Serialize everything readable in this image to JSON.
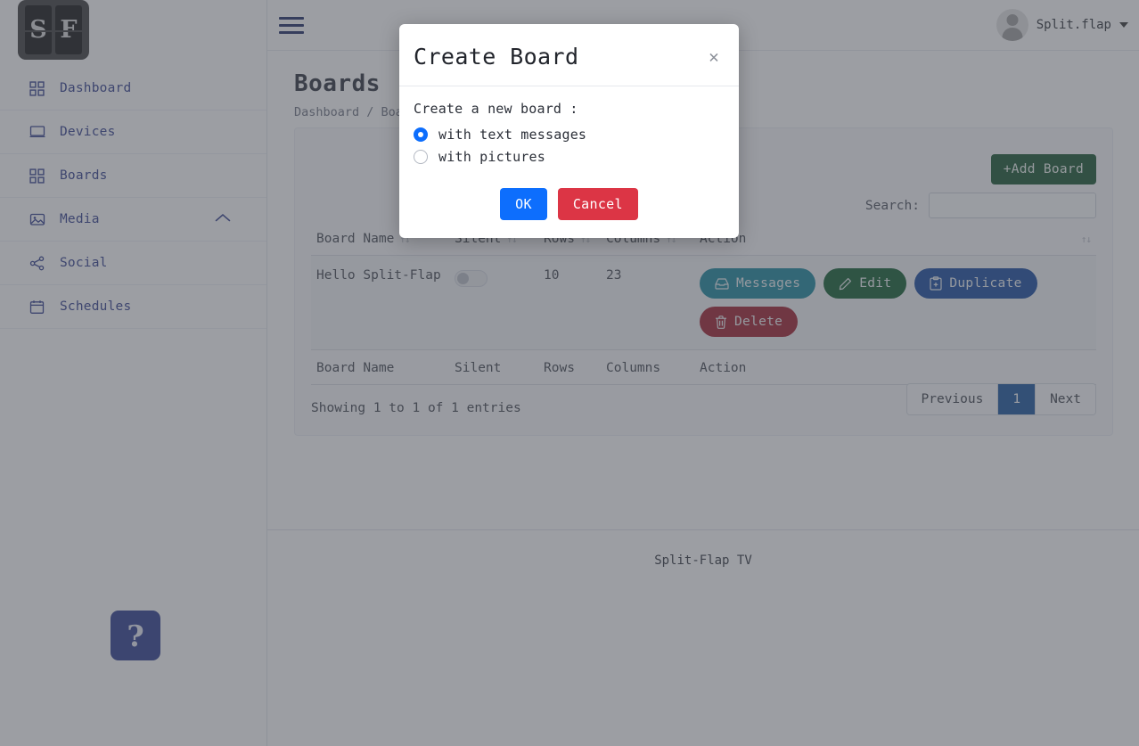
{
  "brand": {
    "tile_1": "S",
    "tile_2": "F"
  },
  "sidebar": {
    "items": [
      {
        "label": "Dashboard",
        "icon": "grid-icon"
      },
      {
        "label": "Devices",
        "icon": "monitor-icon"
      },
      {
        "label": "Boards",
        "icon": "grid-icon"
      },
      {
        "label": "Media",
        "icon": "image-icon",
        "expander": "chevron-up-icon"
      },
      {
        "label": "Social",
        "icon": "share-icon"
      },
      {
        "label": "Schedules",
        "icon": "calendar-icon"
      }
    ]
  },
  "topbar": {
    "menu_icon": "hamburger-icon",
    "user_name": "Split.flap",
    "caret_icon": "caret-down-icon"
  },
  "page": {
    "title": "Boards",
    "breadcrumb": "Dashboard / Boards"
  },
  "toolbar": {
    "add_board_label": "+Add Board",
    "search_label": "Search:",
    "search_value": "",
    "search_placeholder": ""
  },
  "table": {
    "headers": [
      "Board Name",
      "Silent",
      "Rows",
      "Columns",
      "Action"
    ],
    "footers": [
      "Board Name",
      "Silent",
      "Rows",
      "Columns",
      "Action"
    ],
    "sort_icon": "sort-arrows-icon",
    "rows": [
      {
        "name": "Hello Split-Flap",
        "silent": false,
        "rows": "10",
        "columns": "23",
        "actions": [
          {
            "label": "Messages",
            "icon": "inbox-icon",
            "color": "#17859b"
          },
          {
            "label": "Edit",
            "icon": "pencil-icon",
            "color": "#0f5c2e"
          },
          {
            "label": "Duplicate",
            "icon": "clipboard-plus-icon",
            "color": "#14489e"
          },
          {
            "label": "Delete",
            "icon": "trash-icon",
            "color": "#9e1b2a"
          }
        ]
      }
    ],
    "entries_info": "Showing 1 to 1 of 1 entries",
    "pagination": {
      "previous_label": "Previous",
      "pages": [
        "1"
      ],
      "active_page": "1",
      "next_label": "Next"
    }
  },
  "footer": {
    "text": "Split-Flap TV"
  },
  "help": {
    "label": "?",
    "icon": "question-mark-icon"
  },
  "modal": {
    "title": "Create Board",
    "close_icon": "close-icon",
    "prompt": "Create a new board :",
    "options": [
      {
        "label": "with text messages",
        "selected": true
      },
      {
        "label": "with pictures",
        "selected": false
      }
    ],
    "ok_label": "OK",
    "cancel_label": "Cancel"
  },
  "colors": {
    "accent_blue": "#0d6efd",
    "danger_red": "#dc3545",
    "brand_green": "#14532d",
    "sidebar_link": "#2f3c8c",
    "pagination_active": "#17539b"
  }
}
